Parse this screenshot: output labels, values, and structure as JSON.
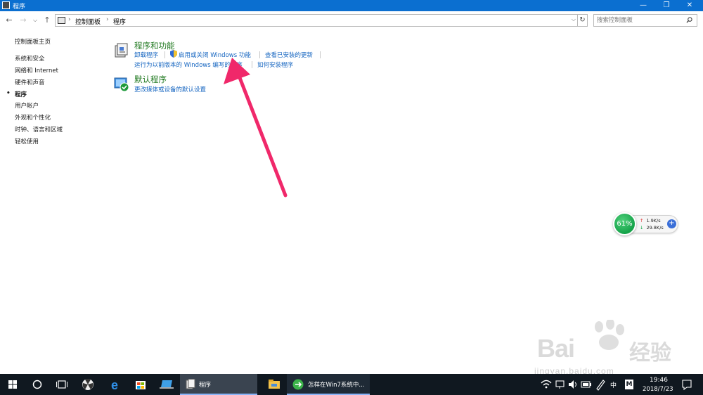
{
  "window": {
    "title": "程序",
    "minimize": "—",
    "restore": "❐",
    "close": "✕"
  },
  "nav": {
    "back": "←",
    "forward": "→",
    "recent": "⌵",
    "up": "↑",
    "refresh": "↻"
  },
  "address": {
    "crumbs": [
      "控制面板",
      "程序"
    ],
    "separator": "›",
    "dropdown": "⌵"
  },
  "search": {
    "placeholder": "搜索控制面板"
  },
  "sidebar": {
    "items": [
      {
        "label": "控制面板主页",
        "active": false
      },
      {
        "label": "系统和安全",
        "active": false
      },
      {
        "label": "网络和 Internet",
        "active": false
      },
      {
        "label": "硬件和声音",
        "active": false
      },
      {
        "label": "程序",
        "active": true
      },
      {
        "label": "用户帐户",
        "active": false
      },
      {
        "label": "外观和个性化",
        "active": false
      },
      {
        "label": "时钟、语言和区域",
        "active": false
      },
      {
        "label": "轻松使用",
        "active": false
      }
    ],
    "bullet": "•"
  },
  "categories": [
    {
      "title": "程序和功能",
      "links_row1": [
        "卸载程序",
        "启用或关闭 Windows 功能",
        "查看已安装的更新"
      ],
      "links_row2": [
        "运行为以前版本的 Windows 编写的程序",
        "如何安装程序"
      ]
    },
    {
      "title": "默认程序",
      "links_row1": [
        "更改媒体或设备的默认设置"
      ]
    }
  ],
  "net_widget": {
    "percent": "61%",
    "upload": "1.9K/s",
    "download": "29.8K/s",
    "up_arrow": "↑",
    "down_arrow": "↓",
    "plus": "+"
  },
  "watermark": {
    "brand": "Bai",
    "brand_cn": "经验",
    "url": "jingyan.baidu.com"
  },
  "taskbar": {
    "apps": [
      {
        "label": "程序",
        "state": "active"
      },
      {
        "label": "怎样在Win7系统中...",
        "state": "open"
      }
    ],
    "tray": {
      "ime": "中",
      "ime_mode": "M",
      "time": "19:46",
      "date": "2018/7/23"
    }
  },
  "colors": {
    "titlebar": "#0b6fd0",
    "category_title": "#217a21",
    "link": "#1565c0",
    "arrow": "#f0286a",
    "taskbar": "#101820"
  }
}
